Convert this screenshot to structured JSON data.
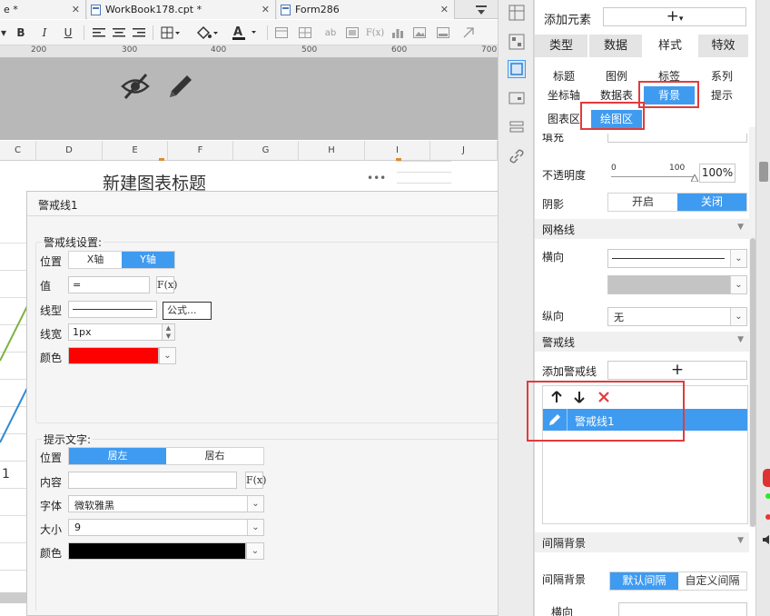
{
  "tabs": [
    {
      "label": "e *",
      "close": "✕"
    },
    {
      "label": "WorkBook178.cpt *",
      "close": "✕"
    },
    {
      "label": "Form286",
      "close": "✕"
    }
  ],
  "ruler_marks": [
    "200",
    "300",
    "400",
    "500",
    "600",
    "700"
  ],
  "columns": [
    "C",
    "D",
    "E",
    "F",
    "G",
    "H",
    "I",
    "J"
  ],
  "chart_title": "新建图表标题",
  "more_dots": "•••",
  "row_marker": "1",
  "dialog": {
    "title": "警戒线1",
    "settings_group": "警戒线设置:",
    "position_label": "位置",
    "pos_x": "X轴",
    "pos_y": "Y轴",
    "value_label": "值",
    "value": "=",
    "fx": "F(x)",
    "linetype_label": "线型",
    "formula_btn": "公式...",
    "linewidth_label": "线宽",
    "linewidth": "1px",
    "color_label": "颜色",
    "line_color": "#ff0000",
    "hint_group": "提示文字:",
    "hint_position_label": "位置",
    "hint_left": "居左",
    "hint_right": "居右",
    "content_label": "内容",
    "font_label": "字体",
    "font_value": "微软雅黑",
    "size_label": "大小",
    "size_value": "9",
    "hint_color_label": "颜色",
    "hint_color": "#000000"
  },
  "panel": {
    "add_element": "添加元素",
    "tabs": [
      "类型",
      "数据",
      "样式",
      "特效"
    ],
    "sub_row1": [
      "标题",
      "图例",
      "标签",
      "系列"
    ],
    "sub_row2": [
      "坐标轴",
      "数据表",
      "背景",
      "提示"
    ],
    "sub_row3": [
      "图表区",
      "绘图区"
    ],
    "cut_row": "填充",
    "opacity_label": "不透明度",
    "opacity_min": "0",
    "opacity_max": "100",
    "opacity_value": "100%",
    "shadow_label": "阴影",
    "shadow_on": "开启",
    "shadow_off": "关闭",
    "grid_section": "网格线",
    "horizontal_label": "横向",
    "vertical_label": "纵向",
    "vertical_value": "无",
    "alert_section": "警戒线",
    "add_alert_label": "添加警戒线",
    "add_alert_plus": "+",
    "alert_items": [
      "警戒线1"
    ],
    "interval_section": "间隔背景",
    "interval_label": "间隔背景",
    "interval_default": "默认间隔",
    "interval_custom": "自定义间隔",
    "interval_horizontal": "横向"
  }
}
